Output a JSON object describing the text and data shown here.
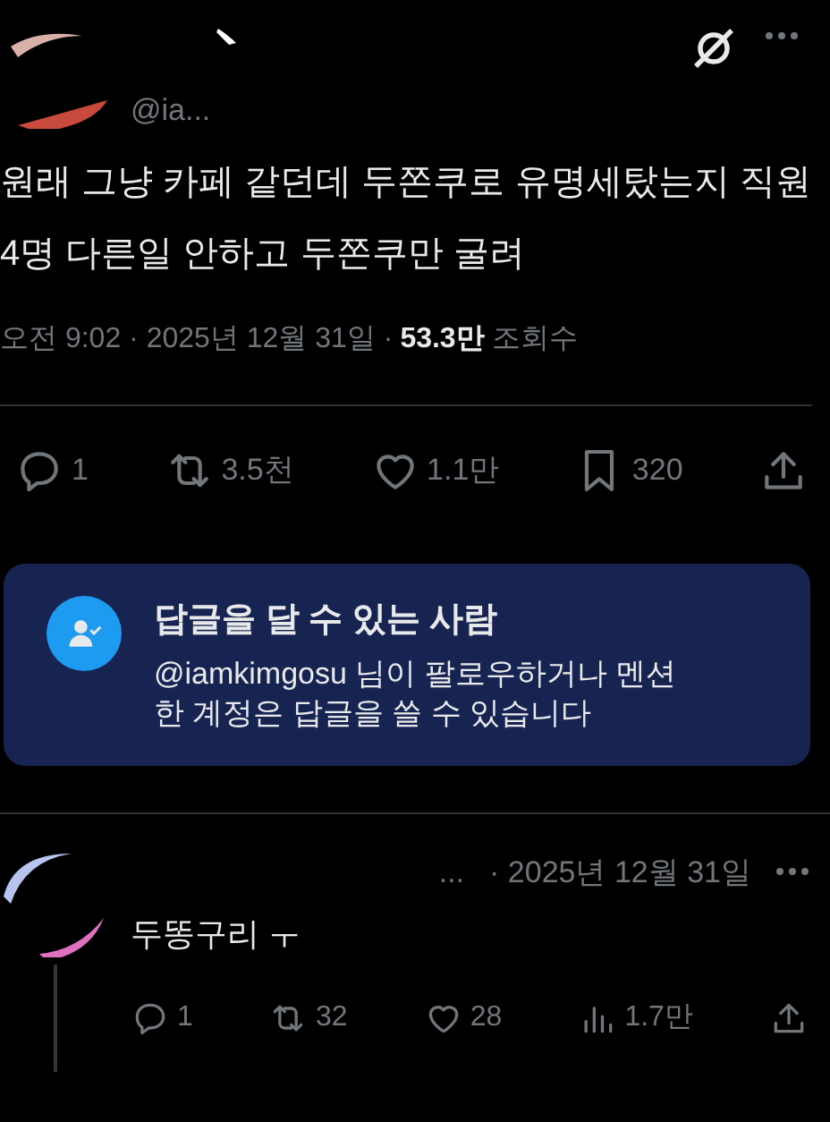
{
  "tweet": {
    "handle": "@ia...",
    "text": "원래 그냥 카페 같던데 두쫀쿠로 유명세탔는지 직원4명 다른일 안하고 두쫀쿠만 굴려",
    "time": "오전 9:02",
    "separator": "·",
    "date": "2025년 12월 31일",
    "views_count": "53.3만",
    "views_label": "조회수",
    "actions": [
      {
        "kind": "reply",
        "count": "1"
      },
      {
        "kind": "repost",
        "count": "3.5천"
      },
      {
        "kind": "like",
        "count": "1.1만"
      },
      {
        "kind": "bookmark",
        "count": "320"
      },
      {
        "kind": "share"
      }
    ]
  },
  "reply_notice": {
    "title": "답글을 달 수 있는 사람",
    "body": "@iamkimgosu 님이 팔로우하거나 멘션한 계정은 답글을 쓸 수 있습니다"
  },
  "reply": {
    "name": "...",
    "date": "· 2025년 12월 31일",
    "text": "두똥구리 ㅜ",
    "actions": [
      {
        "kind": "reply",
        "count": "1"
      },
      {
        "kind": "repost",
        "count": "32"
      },
      {
        "kind": "like",
        "count": "28"
      },
      {
        "kind": "views",
        "count": "1.7만"
      },
      {
        "kind": "share"
      }
    ]
  }
}
